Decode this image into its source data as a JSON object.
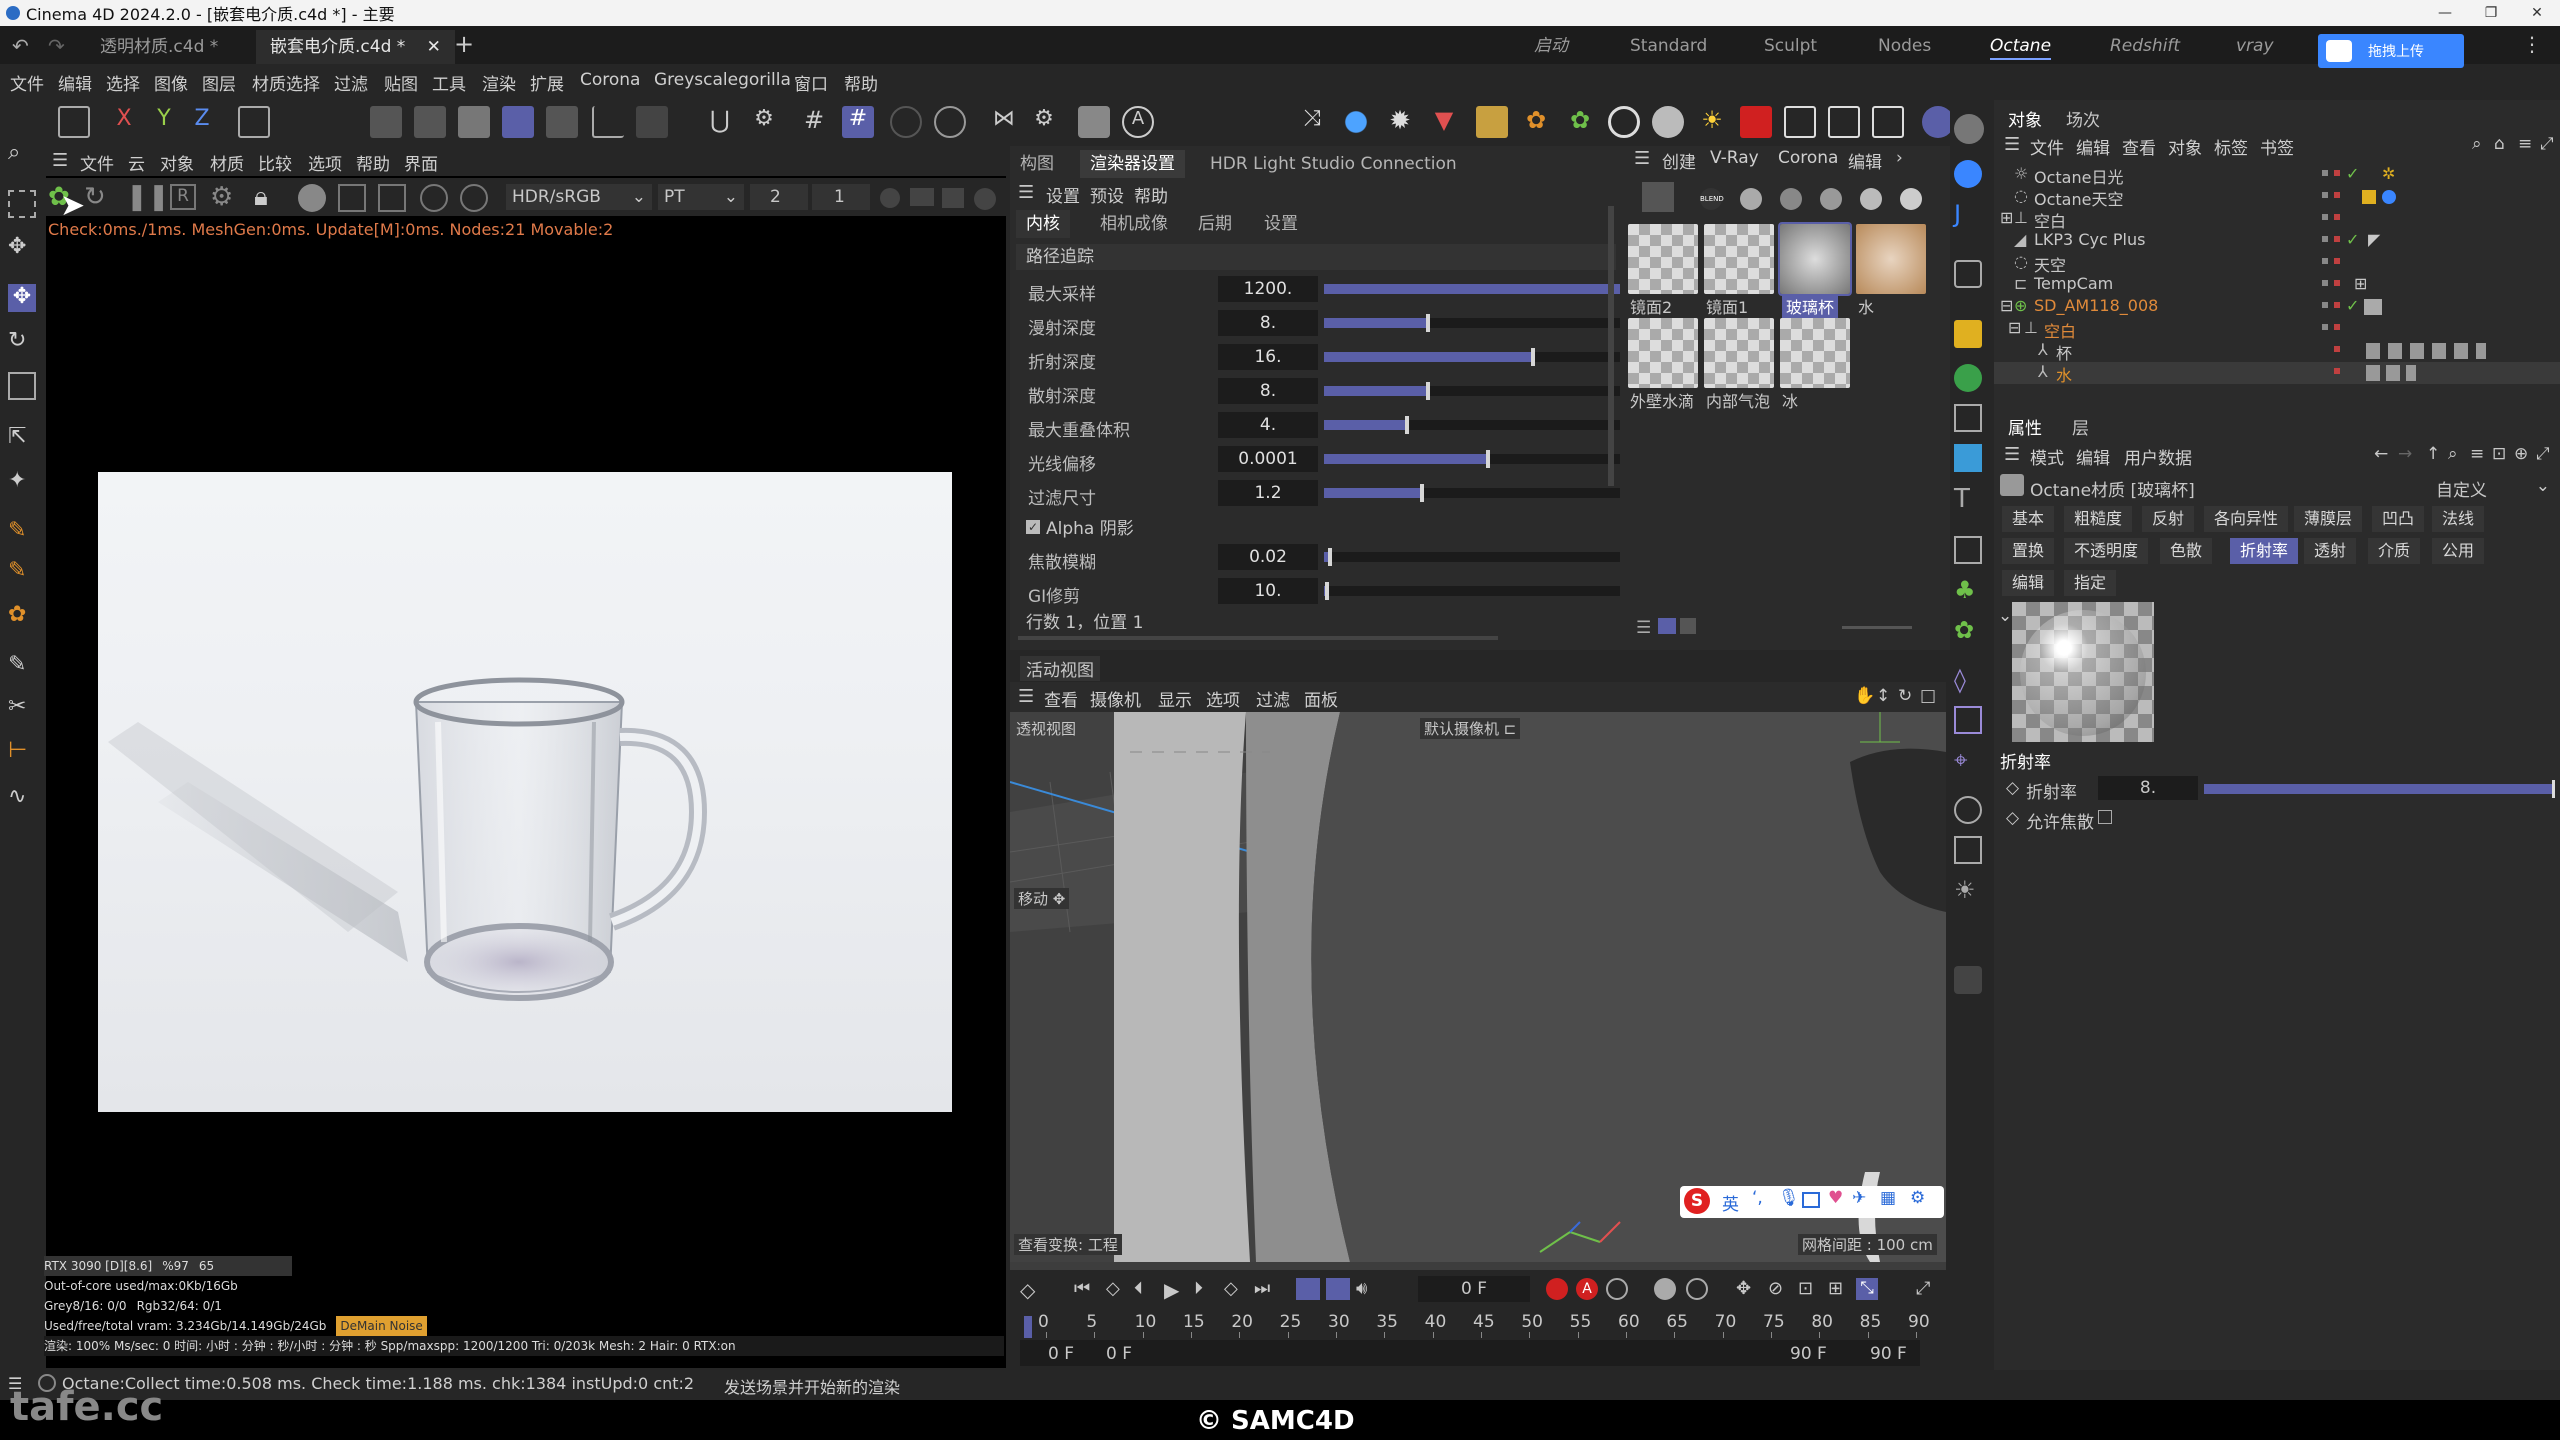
{
  "window": {
    "title": "Cinema 4D 2024.2.0 - [嵌套电介质.c4d *] - 主要"
  },
  "doc_tabs": [
    {
      "label": "透明材质.c4d *"
    },
    {
      "label": "嵌套电介质.c4d *"
    }
  ],
  "layouts": [
    "启动",
    "Standard",
    "Sculpt",
    "Nodes",
    "Octane",
    "Redshift",
    "vray"
  ],
  "upload_label": "拖拽上传",
  "menu": [
    "文件",
    "编辑",
    "选择",
    "图像",
    "图层",
    "材质选择",
    "过滤",
    "贴图",
    "工具",
    "渲染",
    "扩展",
    "Corona",
    "Greyscalegorilla",
    "窗口",
    "帮助"
  ],
  "render_menu": [
    "文件",
    "云",
    "对象",
    "材质",
    "比较",
    "选项",
    "帮助",
    "界面"
  ],
  "render_toolbar": {
    "colorspace": "HDR/sRGB",
    "mode": "PT",
    "num1": "2",
    "num2": "1"
  },
  "render_status": "Check:0ms./1ms. MeshGen:0ms. Update[M]:0ms. Nodes:21 Movable:2",
  "render_info": {
    "gpu": "RTX 3090 [D][8.6]",
    "gpu_pct": "%97",
    "gpu_temp": "65",
    "ooc": "Out-of-core used/max:0Kb/16Gb",
    "grey": "Grey8/16: 0/0",
    "rgb": "Rgb32/64: 0/1",
    "vram": "Used/free/total vram: 3.234Gb/14.149Gb/24Gb",
    "noise": "DeMain Noise",
    "stats": "渲染:    100%   Ms/sec: 0   时间: 小时 : 分钟 : 秒/小时 : 分钟 : 秒   Spp/maxspp: 1200/1200   Tri: 0/203k   Mesh: 2   Hair: 0   RTX:on"
  },
  "mid_panel": {
    "top_tabs": [
      "构图",
      "渲染器设置",
      "HDR Light Studio Connection"
    ],
    "sub_menu": [
      "设置",
      "预设",
      "帮助"
    ],
    "kernel_tabs": [
      "内核",
      "相机成像",
      "后期",
      "设置"
    ],
    "section": "路径追踪",
    "params": [
      {
        "label": "最大采样",
        "value": "1200.",
        "pct": 1.0
      },
      {
        "label": "漫射深度",
        "value": "8.",
        "pct": 0.35
      },
      {
        "label": "折射深度",
        "value": "16.",
        "pct": 0.7
      },
      {
        "label": "散射深度",
        "value": "8.",
        "pct": 0.35
      },
      {
        "label": "最大重叠体积",
        "value": "4.",
        "pct": 0.28
      },
      {
        "label": "光线偏移",
        "value": "0.0001",
        "pct": 0.55
      },
      {
        "label": "过滤尺寸",
        "value": "1.2",
        "pct": 0.33
      }
    ],
    "alpha_shadow": "Alpha 阴影",
    "params2": [
      {
        "label": "焦散模糊",
        "value": "0.02",
        "pct": 0.02
      },
      {
        "label": "GI修剪",
        "value": "10.",
        "pct": 0.01
      }
    ],
    "footer": "行数 1，位置 1"
  },
  "mat_panel": {
    "menu": [
      "创建",
      "V-Ray",
      "Corona",
      "编辑"
    ],
    "materials": [
      "镜面2",
      "镜面1",
      "玻璃杯",
      "水",
      "外壁水滴",
      "内部气泡",
      "冰"
    ]
  },
  "viewport": {
    "title": "活动视图",
    "menu": [
      "查看",
      "摄像机",
      "显示",
      "选项",
      "过滤",
      "面板"
    ],
    "label": "透视视图",
    "camera": "默认摄像机",
    "move": "移动",
    "transform": "查看变换: 工程",
    "grid": "网格间距 : 100 cm"
  },
  "timeline": {
    "frame": "0 F",
    "ticks": [
      "0",
      "5",
      "10",
      "15",
      "20",
      "25",
      "30",
      "35",
      "40",
      "45",
      "50",
      "55",
      "60",
      "65",
      "70",
      "75",
      "80",
      "85",
      "90"
    ],
    "start1": "0 F",
    "start2": "0 F",
    "end1": "90 F",
    "end2": "90 F"
  },
  "obj_panel": {
    "tabs": [
      "对象",
      "场次"
    ],
    "menu": [
      "文件",
      "编辑",
      "查看",
      "对象",
      "标签",
      "书签"
    ],
    "objects": [
      {
        "name": "Octane日光",
        "indent": 0
      },
      {
        "name": "Octane天空",
        "indent": 0
      },
      {
        "name": "空白",
        "indent": 0
      },
      {
        "name": "LKP3 Cyc Plus",
        "indent": 0
      },
      {
        "name": "天空",
        "indent": 0
      },
      {
        "name": "TempCam",
        "indent": 0
      },
      {
        "name": "SD_AM118_008",
        "indent": 0
      },
      {
        "name": "空白",
        "indent": 1
      },
      {
        "name": "杯",
        "indent": 2
      },
      {
        "name": "水",
        "indent": 2
      }
    ]
  },
  "attr_panel": {
    "tabs": [
      "属性",
      "层"
    ],
    "menu": [
      "模式",
      "编辑",
      "用户数据"
    ],
    "material_name": "Octane材质 [玻璃杯]",
    "preset": "自定义",
    "row1": [
      "基本",
      "粗糙度",
      "反射",
      "各向异性",
      "薄膜层",
      "凹凸",
      "法线"
    ],
    "row2": [
      "置换",
      "不透明度",
      "色散",
      "折射率",
      "透射",
      "介质",
      "公用"
    ],
    "row3": [
      "编辑",
      "指定"
    ],
    "section": "折射率",
    "ior_label": "折射率",
    "ior_value": "8.",
    "ior_pct": 1.0,
    "caustics": "允许焦散"
  },
  "status_bar": {
    "left": "Octane:Collect time:0.508 ms.  Check time:1.188 ms.  chk:1384  instUpd:0  cnt:2",
    "right": "发送场景并开始新的渲染"
  },
  "footer": {
    "watermark": "tafe.cc",
    "copyright": "© SAMC4D"
  },
  "colors": {
    "accent": "#5a5fa8",
    "status_orange": "#e07a4a",
    "selected_tab": "#7aa0ff"
  }
}
